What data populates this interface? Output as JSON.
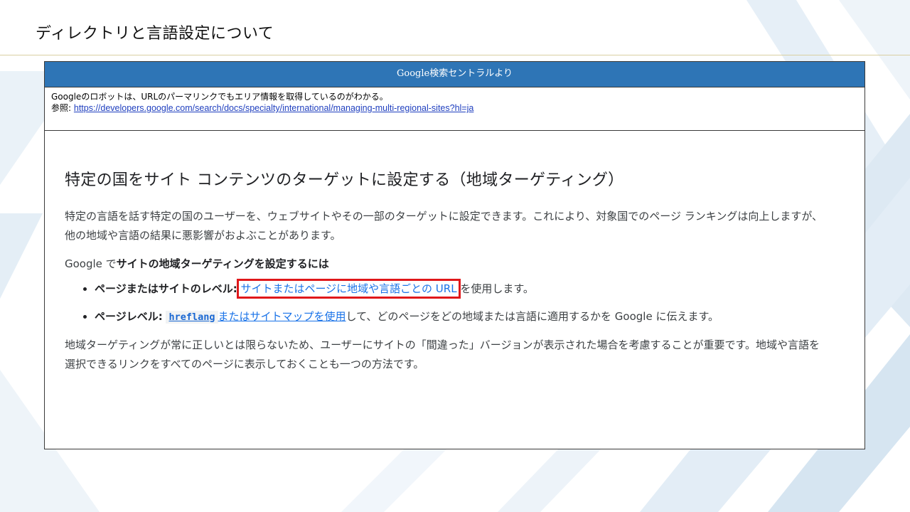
{
  "slide": {
    "title": "ディレクトリと言語設定について"
  },
  "panel": {
    "header": "Google検索セントラルより",
    "note": "Googleのロボットは、URLのパーマリンクでもエリア情報を取得しているのがわかる。",
    "ref_label": "参照:",
    "ref_url": "https://developers.google.com/search/docs/specialty/international/managing-multi-regional-sites?hl=ja"
  },
  "doc": {
    "heading": "特定の国をサイト コンテンツのターゲットに設定する（地域ターゲティング）",
    "intro": "特定の言語を話す特定の国のユーザーを、ウェブサイトやその一部のターゲットに設定できます。これにより、対象国でのページ ランキングは向上しますが、他の地域や言語の結果に悪影響がおよぶことがあります。",
    "lead_prefix": "Google で",
    "lead_bold": "サイトの地域ターゲティングを設定するには",
    "bullets": [
      {
        "label": "ページまたはサイトのレベル:",
        "link": "サイトまたはページに地域や言語ごとの URL",
        "suffix": "を使用します。"
      },
      {
        "label": "ページレベル:",
        "code": "hreflang",
        "link": "またはサイトマップを使用",
        "suffix": "して、どのページをどの地域または言語に適用するかを Google に伝えます。"
      }
    ],
    "closing": "地域ターゲティングが常に正しいとは限らないため、ユーザーにサイトの「間違った」バージョンが表示された場合を考慮することが重要です。地域や言語を選択できるリンクをすべてのページに表示しておくことも一つの方法です。"
  },
  "colors": {
    "header_bg": "#2e75b6",
    "highlight_border": "#e0181b",
    "link": "#1a73e8"
  }
}
